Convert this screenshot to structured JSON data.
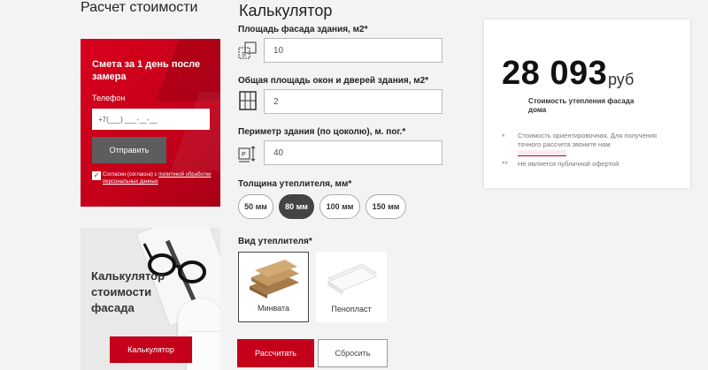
{
  "left": {
    "heading": "Расчет стоимости",
    "promo": {
      "title": "Смета за 1 день после замера",
      "phone_label": "Телефон",
      "phone_placeholder": "+7(___) ___-__-__",
      "send_button": "Отправить",
      "consent_text": "Согласен (согласна) с",
      "consent_link": "политикой обработки персональных данных"
    },
    "calc_promo": {
      "title": "Калькулятор стоимости фасада",
      "button": "Калькулятор"
    }
  },
  "calculator": {
    "heading": "Калькулятор",
    "area_label": "Площадь фасада здания, м2*",
    "area_value": "10",
    "windows_label": "Общая площадь окон и дверей здания, м2*",
    "windows_value": "2",
    "perimeter_label": "Периметр здания (по цоколю), м. пог.*",
    "perimeter_value": "40",
    "thickness_label": "Толщина утеплителя, мм*",
    "thickness_options": [
      "50 мм",
      "80 мм",
      "100 мм",
      "150 мм"
    ],
    "thickness_selected": "80 мм",
    "type_label": "Вид утеплителя*",
    "types": [
      "Минвата",
      "Пенопласт"
    ],
    "type_selected": "Минвата",
    "calc_button": "Рассчитать",
    "reset_button": "Сбросить"
  },
  "result": {
    "price": "28 093",
    "unit": "руб",
    "caption": "Стоимость утепления фасада дома",
    "note1_marker": "*",
    "note1": "Стоимость ориентировочная. Для получения точного рассчета звоните нам",
    "note2_marker": "**",
    "note2": "Не является публичной офертой"
  },
  "colors": {
    "accent": "#c4001a",
    "dark": "#444444"
  }
}
